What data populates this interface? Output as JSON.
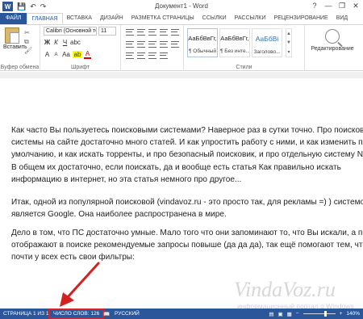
{
  "window": {
    "title": "Документ1 - Word",
    "help": "?",
    "minimize": "—",
    "restore": "❐",
    "close": "✕"
  },
  "quick_access": {
    "logo": "W",
    "save": "💾",
    "undo": "↶",
    "redo": "↷"
  },
  "tabs": [
    {
      "label": "ФАЙЛ"
    },
    {
      "label": "ГЛАВНАЯ"
    },
    {
      "label": "ВСТАВКА"
    },
    {
      "label": "ДИЗАЙН"
    },
    {
      "label": "РАЗМЕТКА СТРАНИЦЫ"
    },
    {
      "label": "ССЫЛКИ"
    },
    {
      "label": "РАССЫЛКИ"
    },
    {
      "label": "РЕЦЕНЗИРОВАНИЕ"
    },
    {
      "label": "ВИД"
    }
  ],
  "ribbon": {
    "clipboard": {
      "paste": "Вставить",
      "label": "Буфер обмена"
    },
    "font": {
      "name": "Calibri (Основной те",
      "size": "11",
      "label": "Шрифт",
      "bold": "Ж",
      "italic": "К",
      "underline": "Ч",
      "grow": "A",
      "shrink": "A",
      "clear": "Aa",
      "highlight": "ab",
      "color": "A"
    },
    "paragraph": {
      "label": ""
    },
    "styles": {
      "label": "Стили",
      "items": [
        {
          "sample": "АаБбВвГг,",
          "name": "¶ Обычный"
        },
        {
          "sample": "АаБбВвГг,",
          "name": "¶ Без инте..."
        },
        {
          "sample": "АаБбВі",
          "name": "Заголово..."
        }
      ]
    },
    "editing": {
      "label": "Редактирование"
    }
  },
  "document": {
    "p1": [
      "Как часто Вы пользуетесь поисковыми системами? Наверное раз в сутки точно. Про поисковые",
      "системы на сайте достаточно много статей. И как упростить работу с ними, и как изменить по",
      "умолчанию, и как искать торренты, и про безопасный поисковик, и про отдельную систему N",
      "В общем их достаточно, если поискать, да и вообще есть статья Как правильно искать",
      "информацию в интернет, но эта статья немного про другое..."
    ],
    "p2": [
      "Итак, одной из популярной поисковой (vindavoz.ru - это просто так, для рекламы =) ) системо",
      "является Google. Она наиболее распространена в мире."
    ],
    "p3": [
      "Дело в том, что ПС достаточно умные. Мало того что они запоминают то, что Вы искали, а пот",
      "отображают в поиске рекомендуемые запросы повыше (да да да), так ещё помогают тем, что",
      "почти у всех есть свои фильтры:"
    ]
  },
  "watermark": {
    "main": "VindaVoz.ru",
    "sub": "информационный портал о Windows"
  },
  "status_bar": {
    "page": "СТРАНИЦА 1 ИЗ 1",
    "words": "ЧИСЛО СЛОВ: 126",
    "language": "РУССКИЙ",
    "zoom": "140%",
    "zoom_minus": "−",
    "zoom_plus": "+"
  },
  "colors": {
    "accent": "#2b579a",
    "highlight_box": "#e02020",
    "arrow": "#d42020"
  }
}
